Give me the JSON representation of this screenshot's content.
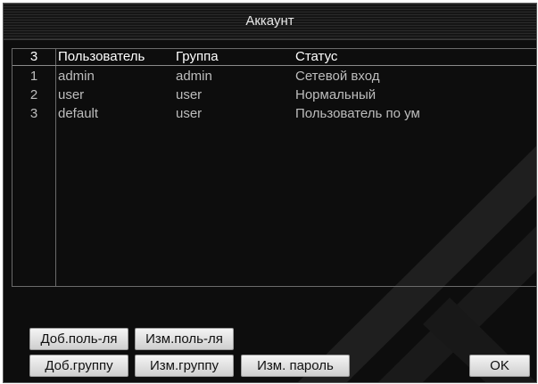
{
  "dialog": {
    "title": "Аккаунт"
  },
  "table": {
    "headers": [
      "3",
      "Пользователь",
      "Группа",
      "Статус"
    ],
    "rows": [
      [
        "1",
        "admin",
        "admin",
        "Сетевой вход"
      ],
      [
        "2",
        "user",
        "user",
        "Нормальный"
      ],
      [
        "3",
        "default",
        "user",
        "Пользователь по ум"
      ]
    ]
  },
  "buttons": {
    "add_user": "Доб.поль-ля",
    "edit_user": "Изм.поль-ля",
    "add_group": "Доб.группу",
    "edit_group": "Изм.группу",
    "change_password": "Изм. пароль",
    "ok": "OK"
  },
  "colors": {
    "background": "#0d0d0d",
    "text_header": "#ffffff",
    "text_row": "#bdbdbd",
    "button_face": "#e6e6e6"
  }
}
